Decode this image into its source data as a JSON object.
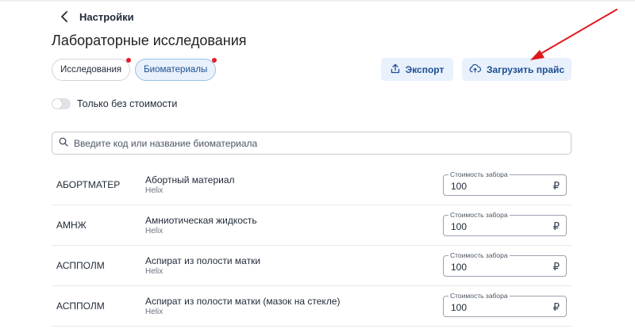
{
  "header": {
    "back_label": "Настройки",
    "title": "Лабораторные исследования"
  },
  "tabs": [
    {
      "label": "Исследования",
      "active": false,
      "has_dot": true
    },
    {
      "label": "Биоматериалы",
      "active": true,
      "has_dot": true
    }
  ],
  "actions": {
    "export_label": "Экспорт",
    "upload_label": "Загрузить прайс"
  },
  "filter": {
    "toggle_label": "Только без стоимости",
    "toggle_on": false
  },
  "search": {
    "placeholder": "Введите код или название биоматериала",
    "value": ""
  },
  "price_field_label": "Стоимость забора",
  "currency_symbol": "₽",
  "rows": [
    {
      "code": "АБОРТМАТЕР",
      "name": "Абортный материал",
      "source": "Helix",
      "price": "100"
    },
    {
      "code": "АМНЖ",
      "name": "Амниотическая жидкость",
      "source": "Helix",
      "price": "100"
    },
    {
      "code": "АСППОЛМ",
      "name": "Аспират из полости матки",
      "source": "Helix",
      "price": "100"
    },
    {
      "code": "АСППОЛМ",
      "name": "Аспират из полости матки (мазок на стекле)",
      "source": "Helix",
      "price": "100"
    }
  ],
  "colors": {
    "accent": "#1d4f91",
    "accent_bg": "#e8f1fc",
    "badge_dot": "#e11d2a",
    "annotation_arrow": "#e0161d"
  }
}
